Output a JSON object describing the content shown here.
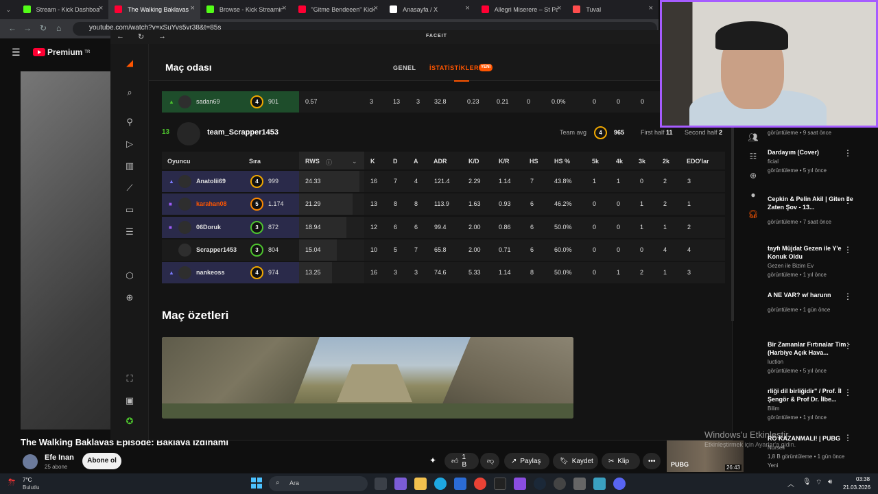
{
  "browser": {
    "tabs": [
      {
        "label": "Stream - Kick Dashboard",
        "fav": "#53fc18"
      },
      {
        "label": "The Walking Baklavas Epi",
        "fav": "#ff0033"
      },
      {
        "label": "Browse - Kick Streaming",
        "fav": "#53fc18"
      },
      {
        "label": "\"Gitme Bendeeen\" Kick &",
        "fav": "#ff0033"
      },
      {
        "label": "Anasayfa / X",
        "fav": "#ffffff"
      },
      {
        "label": "Allegri Miserere – St Paul",
        "fav": "#ff0033"
      },
      {
        "label": "Tuval",
        "fav": "#ff4d4d"
      }
    ],
    "url": "youtube.com/watch?v=xSuYvs5vr38&t=85s"
  },
  "youtube": {
    "logo": "Premium",
    "logo_region": "TR",
    "video_title": "The Walking Baklavas Episode: Baklava İzdihamı",
    "channel": "Efe Inan",
    "subscribers": "25 abone",
    "subscribe_label": "Abone ol",
    "like_count": "1 B",
    "share_label": "Paylaş",
    "save_label": "Kaydet",
    "clip_label": "Klip",
    "recommendations": [
      {
        "title": "Dardayım (Cover)",
        "meta1": "ficial",
        "meta2": "görüntüleme • 5 yıl önce"
      },
      {
        "title": "Cepkin & Pelin Akil | Giten ile Zaten Şov - 13...",
        "meta1": "",
        "meta2": "görüntüleme • 7 saat önce"
      },
      {
        "title": "tayfı Müjdat Gezen ile Y'e Konuk Oldu",
        "meta1": "Gezen ile Bizim Ev",
        "meta2": "görüntüleme • 1 yıl önce"
      },
      {
        "title": "A NE VAR? w/ harunn",
        "meta1": "",
        "meta2": "görüntüleme • 1 gün önce"
      },
      {
        "title": "Bir Zamanlar Fırtınalar Tim - (Harbiye Açık Hava...",
        "meta1": "luction",
        "meta2": "görüntüleme • 5 yıl önce"
      },
      {
        "title": "rliği dil birliğidir\" / Prof. İl Şengör & Prof Dr. İlbe...",
        "meta1": "Bilim",
        "meta2": "görüntüleme • 1 yıl önce"
      }
    ],
    "top_rec_meta": "görüntüleme • 9 saat önce",
    "bottom_rec": {
      "title": "RO KAZANMALI! | PUBG",
      "channel": "Nurseli",
      "meta": "1,8 B görüntüleme • 1 gün önce",
      "badge": "Yeni",
      "duration": "26:43",
      "thumb_text": "PUBG"
    }
  },
  "faceit": {
    "brand": "FACEIT",
    "title": "Maç odası",
    "tabs": {
      "general": "GENEL",
      "stats": "İSTATİSTİKLER",
      "new_badge": "YENİ"
    },
    "prev_row": {
      "name": "sadan69",
      "level": "4",
      "elo": "901",
      "rws": "0.57",
      "k": "3",
      "d": "13",
      "a": "3",
      "adr": "32.8",
      "kd": "0.23",
      "kr": "0.21",
      "hs": "0",
      "hsp": "0.0%",
      "k5": "0",
      "k4": "0",
      "k3": "0"
    },
    "team": {
      "number": "13",
      "name": "team_Scrapper1453",
      "avg_label": "Team avg",
      "avg_level": "4",
      "avg_elo": "965",
      "first_half_label": "First half",
      "first_half": "11",
      "second_half_label": "Second half",
      "second_half": "2"
    },
    "columns": {
      "player": "Oyuncu",
      "rank": "Sıra",
      "rws": "RWS",
      "k": "K",
      "d": "D",
      "a": "A",
      "adr": "ADR",
      "kd": "K/D",
      "kr": "K/R",
      "hs": "HS",
      "hsp": "HS %",
      "k5": "5k",
      "k4": "4k",
      "k3": "3k",
      "k2": "2k",
      "elo": "EDO'lar"
    },
    "players": [
      {
        "name": "Anatolii69",
        "level": "4",
        "elo": "999",
        "rws": "24.33",
        "k": "16",
        "d": "7",
        "a": "4",
        "adr": "121.4",
        "kd": "2.29",
        "kr": "1.14",
        "hs": "7",
        "hsp": "43.8%",
        "k5": "1",
        "k4": "1",
        "k3": "0",
        "k2": "2",
        "edo": "3",
        "rws_fill": 0.93
      },
      {
        "name": "karahan08",
        "level": "5",
        "elo": "1.174",
        "rws": "21.29",
        "k": "13",
        "d": "8",
        "a": "8",
        "adr": "113.9",
        "kd": "1.63",
        "kr": "0.93",
        "hs": "6",
        "hsp": "46.2%",
        "k5": "0",
        "k4": "0",
        "k3": "1",
        "k2": "2",
        "edo": "1",
        "rws_fill": 0.82
      },
      {
        "name": "06Doruk",
        "level": "3",
        "elo": "872",
        "rws": "18.94",
        "k": "12",
        "d": "6",
        "a": "6",
        "adr": "99.4",
        "kd": "2.00",
        "kr": "0.86",
        "hs": "6",
        "hsp": "50.0%",
        "k5": "0",
        "k4": "0",
        "k3": "1",
        "k2": "1",
        "edo": "2",
        "rws_fill": 0.73
      },
      {
        "name": "Scrapper1453",
        "level": "3",
        "elo": "804",
        "rws": "15.04",
        "k": "10",
        "d": "5",
        "a": "7",
        "adr": "65.8",
        "kd": "2.00",
        "kr": "0.71",
        "hs": "6",
        "hsp": "60.0%",
        "k5": "0",
        "k4": "0",
        "k3": "0",
        "k2": "4",
        "edo": "4",
        "rws_fill": 0.58
      },
      {
        "name": "nankeoss",
        "level": "4",
        "elo": "974",
        "rws": "13.25",
        "k": "16",
        "d": "3",
        "a": "3",
        "adr": "74.6",
        "kd": "5.33",
        "kr": "1.14",
        "hs": "8",
        "hsp": "50.0%",
        "k5": "0",
        "k4": "1",
        "k3": "2",
        "k2": "1",
        "edo": "3",
        "rws_fill": 0.51
      }
    ],
    "highlights_title": "Maç özetleri"
  },
  "windows": {
    "activate_title": "Windows'u Etkinleştir",
    "activate_sub": "Etkinleştirmek için Ayarlar'a gidin.",
    "weather_temp": "7°C",
    "weather_desc": "Bulutlu",
    "search": "Ara",
    "time": "03:38",
    "date": "21.03.2026"
  }
}
